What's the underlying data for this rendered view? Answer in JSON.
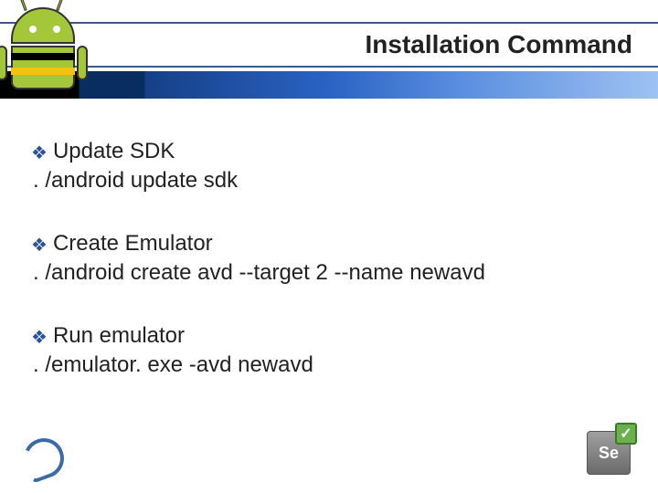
{
  "title": "Installation Command",
  "bullet_glyph": "❖",
  "sections": [
    {
      "heading": "Update SDK",
      "command": ". /android update sdk"
    },
    {
      "heading": "Create Emulator",
      "command": ". /android create avd --target 2 --name newavd"
    },
    {
      "heading": "Run emulator",
      "command": ". /emulator. exe -avd newavd"
    }
  ],
  "footer_badge": "Se",
  "footer_check": "✓"
}
